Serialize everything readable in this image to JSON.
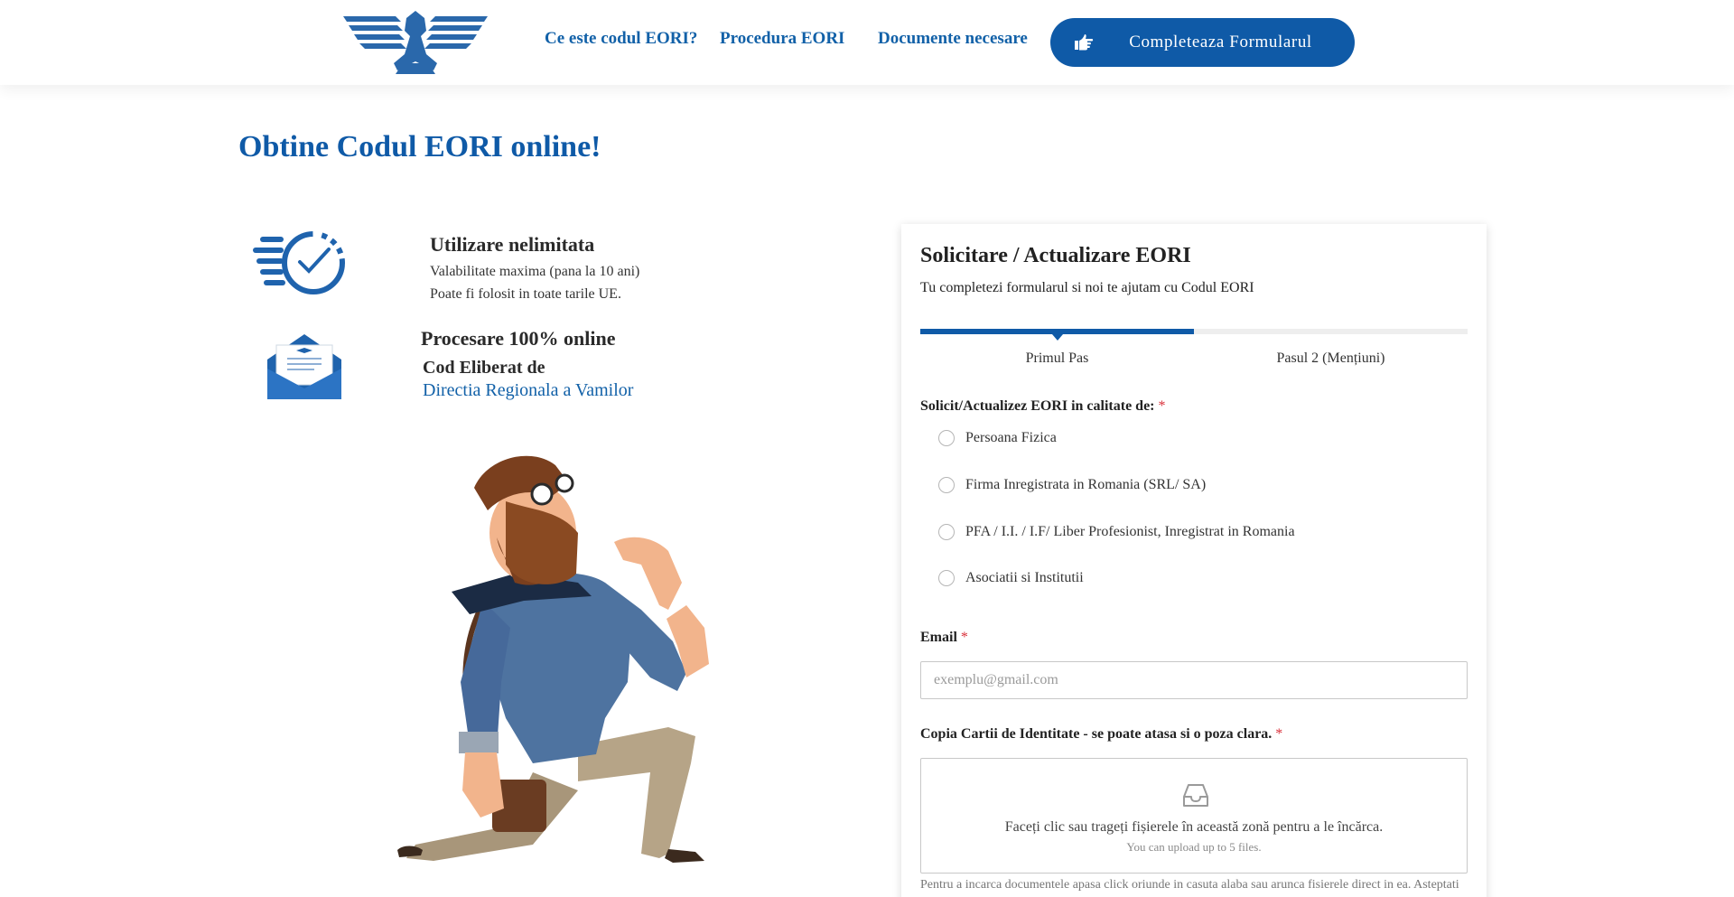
{
  "header": {
    "logo_name": "eagle-logo",
    "nav": [
      {
        "label": "Ce este codul EORI?"
      },
      {
        "label": "Procedura EORI"
      },
      {
        "label": "Documente necesare"
      }
    ],
    "cta_label": "Completeaza Formularul",
    "cta_icon": "pointing-hand-icon"
  },
  "hero": {
    "title": "Obtine Codul EORI online!"
  },
  "features": [
    {
      "icon": "fast-clock-icon",
      "title": "Utilizare nelimitata",
      "lines": [
        "Valabilitate maxima (pana la 10 ani)",
        "Poate fi folosit in toate tarile UE."
      ]
    },
    {
      "icon": "envelope-letter-icon",
      "title": "Procesare 100% online",
      "subtitle": "Cod Eliberat de",
      "link": "Directia Regionala a Vamilor"
    }
  ],
  "form": {
    "title": "Solicitare / Actualizare EORI",
    "subtitle": "Tu completezi formularul si noi te ajutam cu Codul EORI",
    "progress": 0.5,
    "steps": [
      "Primul Pas",
      "Pasul 2 (Mențiuni)"
    ],
    "role_label": "Solicit/Actualizez EORI in calitate de:",
    "required_mark": "*",
    "roles": [
      "Persoana Fizica",
      "Firma Inregistrata in Romania (SRL/ SA)",
      "PFA / I.I. / I.F/ Liber Profesionist, Inregistrat in Romania",
      "Asociatii si Institutii"
    ],
    "email_label": "Email",
    "email_placeholder": "exemplu@gmail.com",
    "email_value": "",
    "id_label": "Copia Cartii de Identitate - se poate atasa si o poza clara.",
    "dropzone_text": "Faceți clic sau trageți fișierele în această zonă pentru a le încărca.",
    "dropzone_sub": "You can upload up to 5 files.",
    "help_text": "Pentru a incarca documentele apasa click oriunde in casuta alaba sau arunca fisierele direct in ea. Asteptati"
  },
  "colors": {
    "brand": "#0f5aa7",
    "link": "#1261a8",
    "required": "#d9303a"
  }
}
